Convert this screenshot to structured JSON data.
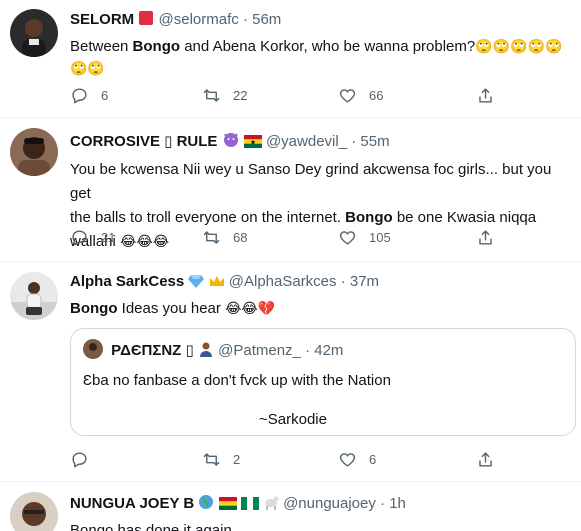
{
  "tweets": [
    {
      "name": "SELORM",
      "handle": "@selormafc",
      "dot": "·",
      "time": "56m",
      "text": {
        "pre": "Between ",
        "bold": "Bongo",
        "post": " and Abena Korkor, who be wanna problem?",
        "emoji_line1": "🙄🙄🙄🙄🙄",
        "emoji_line2": "🙄🙄"
      },
      "replies": "6",
      "retweets": "22",
      "likes": "66"
    },
    {
      "name": "CORROSIVE ▯ RULE",
      "handle": "@yawdevil_",
      "dot": "·",
      "time": "55m",
      "text": {
        "line1": "You be kcwensa Nii wey u Sanso Dey grind akcwensa foc girls... but you get",
        "line2_pre": "the balls to troll everyone on the internet. ",
        "line2_bold": "Bongo",
        "line2_post": " be one Kwasia niqqa",
        "line3": "wallahi ",
        "line3_emoji": "😂😂😂"
      },
      "replies": "21",
      "retweets": "68",
      "likes": "105"
    },
    {
      "name": "Alpha SarkCess",
      "handle": "@AlphaSarkces",
      "dot": "·",
      "time": "37m",
      "text": {
        "bold": "Bongo",
        "post": " Ideas you hear ",
        "emoji": "😂😂💔"
      },
      "quote": {
        "name": "ΡΔЄΠΣΝΖ ▯",
        "handle": "@Patmenz_",
        "dot": "·",
        "time": "42m",
        "text": "Ɛba no fanbase a don't fvck up with the Nation",
        "signature": "~Sarkodie"
      },
      "replies": "",
      "retweets": "2",
      "likes": "6"
    },
    {
      "name": "NUNGUA JOEY B",
      "handle": "@nunguajoey",
      "dot": "·",
      "time": "1h",
      "text": {
        "partial": "Bongo has done it again"
      }
    }
  ],
  "icons": [
    "reply-icon",
    "retweet-icon",
    "like-icon",
    "share-icon"
  ],
  "colors": {
    "text": "#0f1419",
    "secondary": "#536471",
    "border": "#cfd9de",
    "divider": "#eff3f4"
  }
}
